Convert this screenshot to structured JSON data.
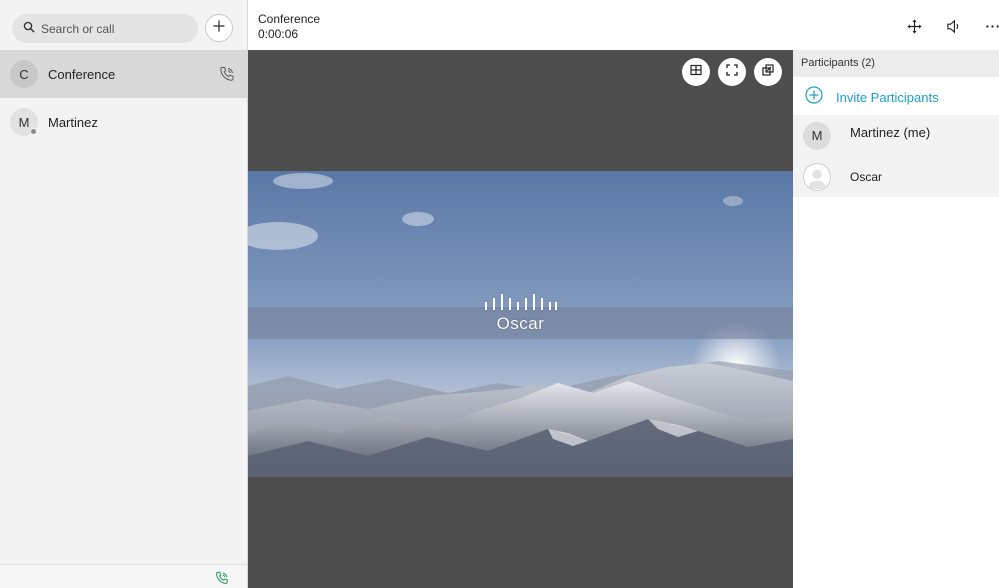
{
  "search": {
    "placeholder": "Search or call"
  },
  "conversations": [
    {
      "initial": "C",
      "name": "Conference"
    },
    {
      "initial": "M",
      "name": "Martinez"
    }
  ],
  "header": {
    "title": "Conference",
    "timer": "0:00:06"
  },
  "video": {
    "participant_name": "Oscar"
  },
  "participants_panel": {
    "title": "Participants (2)",
    "invite_label": "Invite Participants",
    "participants": [
      {
        "initial": "M",
        "name": "Martinez (me)"
      },
      {
        "name": "Oscar"
      }
    ]
  },
  "colors": {
    "accent": "#1aa0c8",
    "stage_bg": "#4d4d4d",
    "active_row": "#d9d9d9"
  },
  "icons": {
    "search": "search-icon",
    "add": "plus-icon",
    "call": "phone-icon",
    "move": "move-icon",
    "volume": "speaker-icon",
    "more": "more-icon",
    "grid": "grid-layout-icon",
    "fullscreen": "fullscreen-icon",
    "popout": "popout-icon",
    "invite": "add-circle-icon"
  }
}
